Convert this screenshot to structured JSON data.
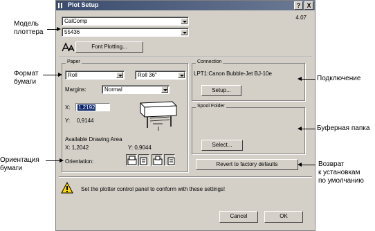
{
  "dialog": {
    "title": "Plot Setup",
    "help_label": "?",
    "close_label": "X",
    "version": "4.07"
  },
  "plotter": {
    "manufacturer": "CalComp",
    "model": "55436",
    "font_plotting_label": "Font Plotting..."
  },
  "paper": {
    "legend": "Paper",
    "type": "Roll",
    "size": "Roll 36\"",
    "margins_label": "Margins:",
    "margins_value": "Normal",
    "x_label": "X:",
    "x_value": "1,2192",
    "y_label": "Y:",
    "y_value": "0,9144",
    "area_title": "Available Drawing Area",
    "area_x": "X:  1,2042",
    "area_y": "Y:  0,9044",
    "orientation_label": "Orientation:"
  },
  "connection": {
    "legend": "Connection",
    "port": "LPT1:Canon Bubble-Jet BJ-10e",
    "setup_label": "Setup..."
  },
  "spool": {
    "legend": "Spool Folder",
    "select_label": "Select..."
  },
  "revert_label": "Revert to factory defaults",
  "warning_text": "Set the plotter control panel to conform with these settings!",
  "cancel_label": "Cancel",
  "ok_label": "OK",
  "annotations": {
    "plotter_model": [
      "Модель",
      "плоттера"
    ],
    "paper_format": [
      "Формат",
      "бумаги"
    ],
    "orientation": [
      "Ориентация",
      "бумаги"
    ],
    "connection": "Подключение",
    "buffer": "Буферная папка",
    "revert": [
      "Возврат",
      "к установкам",
      "по умолчанию"
    ]
  },
  "colors": {
    "dialog_bg": "#d4d0c8",
    "titlebar": "#3a4b6e",
    "warning": "#ffd800"
  }
}
